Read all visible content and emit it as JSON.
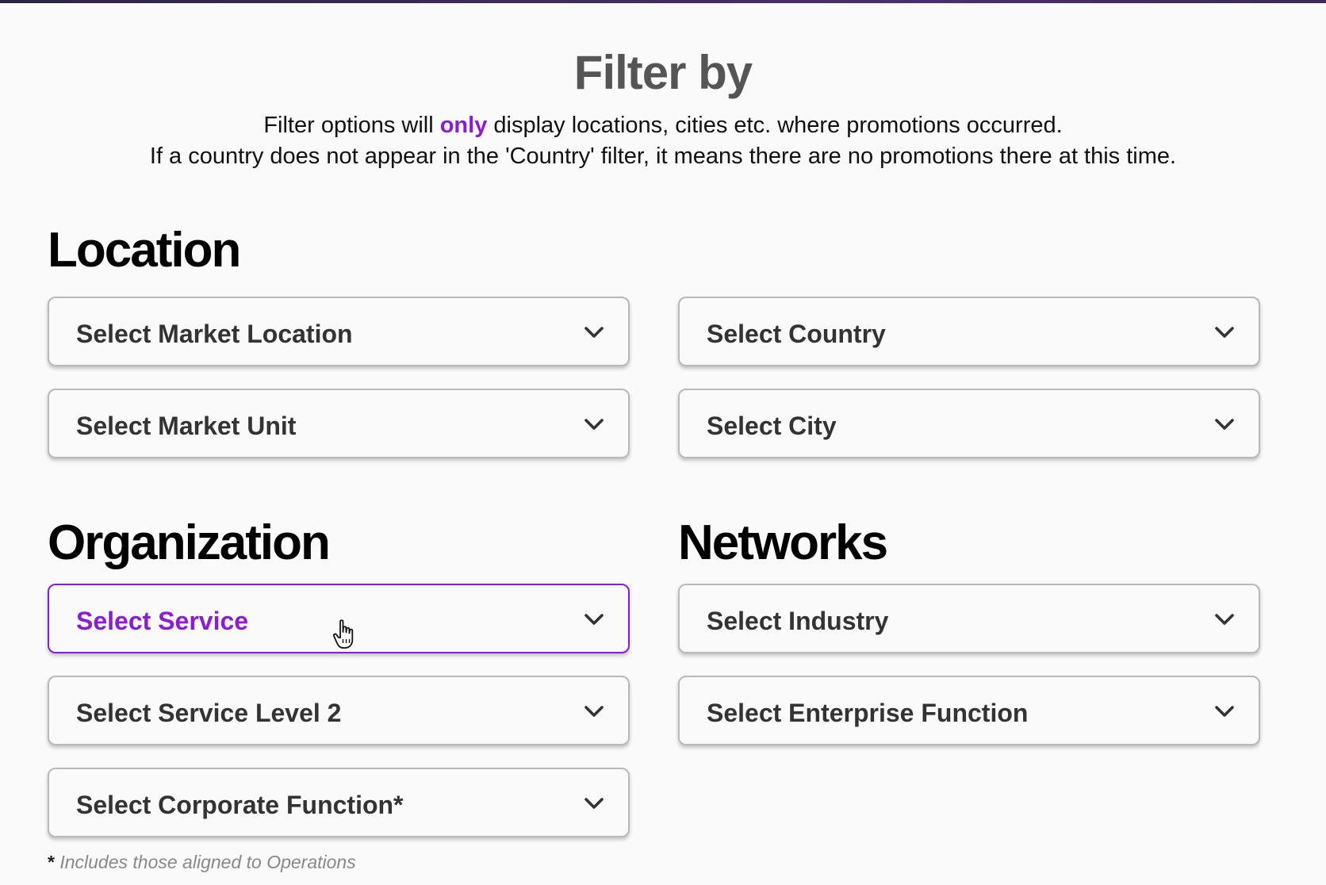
{
  "header": {
    "title": "Filter by",
    "line1_before": "Filter options will ",
    "line1_highlight": "only",
    "line1_after": " display locations, cities etc. where promotions occurred.",
    "line2": "If a country does not appear in the 'Country' filter, it means there are no promotions there at this time."
  },
  "sections": {
    "location": "Location",
    "organization": "Organization",
    "networks": "Networks"
  },
  "dropdowns": {
    "market_location": "Select Market Location",
    "country": "Select Country",
    "market_unit": "Select Market Unit",
    "city": "Select City",
    "service": "Select Service",
    "industry": "Select Industry",
    "service_level_2": "Select Service Level 2",
    "enterprise_function": "Select Enterprise Function",
    "corporate_function": "Select Corporate Function*"
  },
  "footnote": {
    "marker": "*",
    "text": " Includes those aligned to Operations"
  },
  "colors": {
    "accent": "#8a1bd8",
    "title": "#555555",
    "border": "#b9b9b9",
    "background": "#fafafa"
  },
  "icons": {
    "dropdown": "chevron-down-icon",
    "cursor": "hand-pointer-cursor-icon"
  }
}
